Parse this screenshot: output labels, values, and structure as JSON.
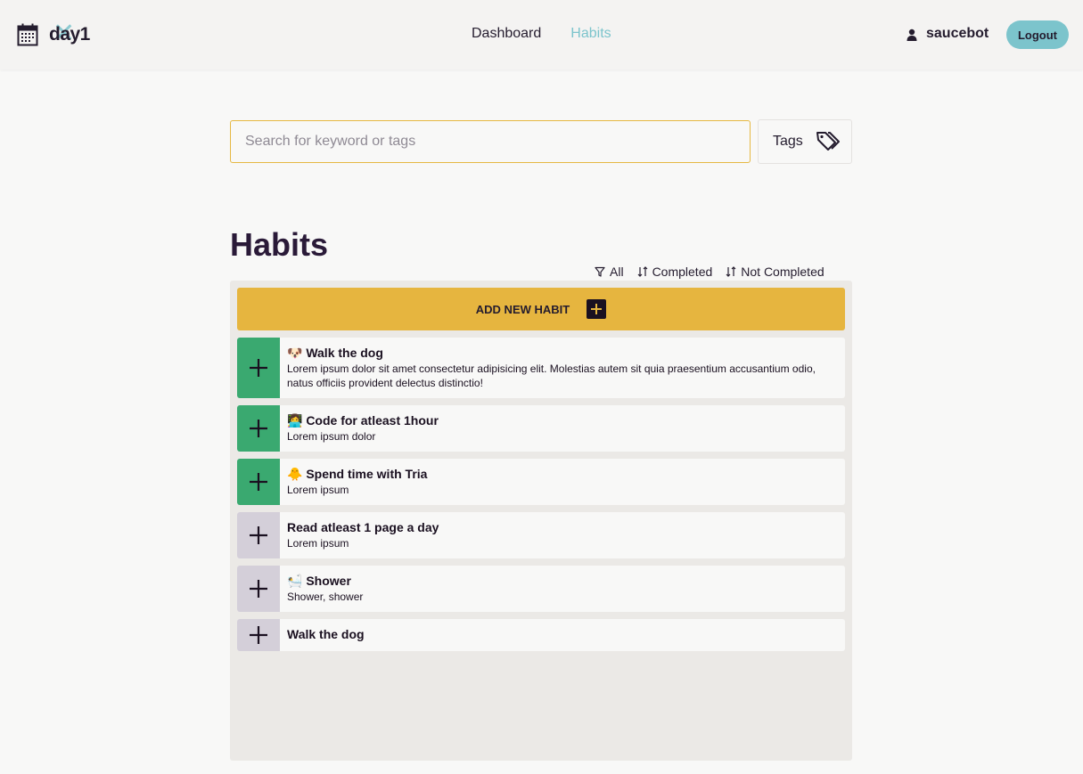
{
  "header": {
    "brand": "day1",
    "nav": [
      {
        "label": "Dashboard",
        "active": false
      },
      {
        "label": "Habits",
        "active": true
      }
    ],
    "username": "saucebot",
    "logout_label": "Logout"
  },
  "search": {
    "placeholder": "Search for keyword or tags",
    "tags_label": "Tags"
  },
  "page": {
    "title": "Habits"
  },
  "filters": [
    {
      "label": "All",
      "icon": "filter-icon"
    },
    {
      "label": "Completed",
      "icon": "sort-icon"
    },
    {
      "label": "Not Completed",
      "icon": "sort-icon"
    }
  ],
  "add_habit_label": "ADD NEW HABIT",
  "habits": [
    {
      "title": "🐶 Walk the dog",
      "description": "Lorem ipsum dolor sit amet consectetur adipisicing elit. Molestias autem sit quia praesentium accusantium odio, natus officiis provident delectus distinctio!",
      "completed": true
    },
    {
      "title": "👩‍💻 Code for atleast 1hour",
      "description": "Lorem ipsum dolor",
      "completed": true
    },
    {
      "title": "🐥 Spend time with Tria",
      "description": "Lorem ipsum",
      "completed": true
    },
    {
      "title": "Read atleast 1 page a day",
      "description": "Lorem ipsum",
      "completed": false
    },
    {
      "title": "🛀 Shower",
      "description": "Shower, shower",
      "completed": false
    },
    {
      "title": "Walk the dog",
      "description": "",
      "completed": false
    }
  ],
  "colors": {
    "accent": "#7cc4cc",
    "add_button": "#e6b53f",
    "completed": "#3aa970",
    "not_completed": "#d4cfd9",
    "dark": "#241c2e"
  }
}
